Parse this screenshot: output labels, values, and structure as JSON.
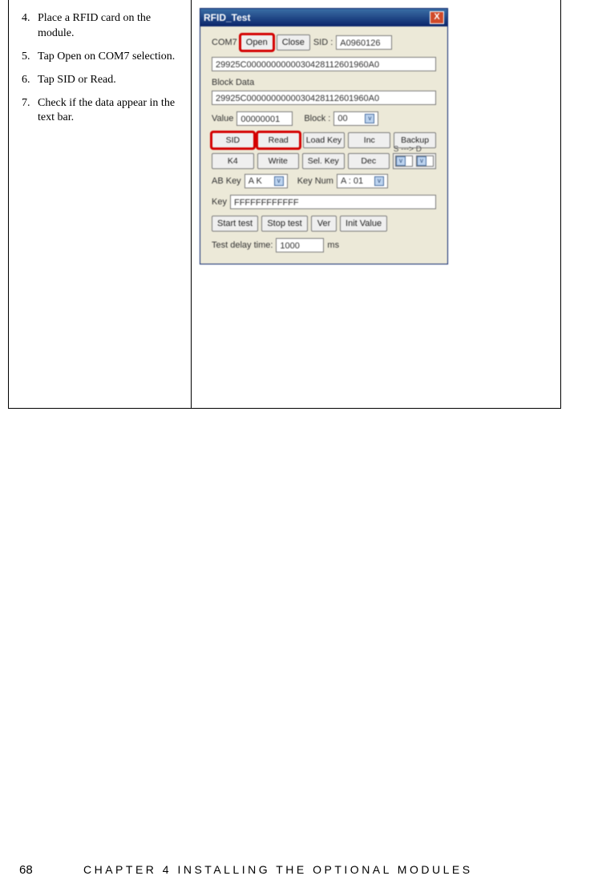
{
  "instructions": [
    {
      "n": "4.",
      "text": "Place a RFID card on the module."
    },
    {
      "n": "5.",
      "text": "Tap Open on COM7 selection."
    },
    {
      "n": "6.",
      "text": "Tap SID or Read."
    },
    {
      "n": "7.",
      "text": "Check if the data appear in the text bar."
    }
  ],
  "window": {
    "title": "RFID_Test",
    "close": "X",
    "com_label": "COM7",
    "open": "Open",
    "close_btn": "Close",
    "sid_label": "SID :",
    "sid_value": "A0960126",
    "data1": "29925C0000000000030428112601960A0",
    "block_data_label": "Block Data",
    "data2": "29925C0000000000030428112601960A0",
    "value_label": "Value",
    "value": "00000001",
    "block_label": "Block :",
    "block_sel": "00",
    "btns_row1": [
      "SID",
      "Read",
      "Load Key",
      "Inc",
      "Backup"
    ],
    "sd_label": "S ---> D",
    "btns_row2": [
      "K4",
      "Write",
      "Sel. Key",
      "Dec"
    ],
    "abkey_label": "AB Key",
    "abkey_sel": "A K",
    "keynum_label": "Key Num",
    "keynum_sel": "A : 01",
    "key_label": "Key",
    "key_value": "FFFFFFFFFFFF",
    "start": "Start test",
    "stop": "Stop test",
    "ver": "Ver",
    "init": "Init Value",
    "delay_label": "Test delay time:",
    "delay_value": "1000",
    "ms": "ms"
  },
  "footer": {
    "page": "68",
    "chapter": "CHAPTER 4 INSTALLING THE OPTIONAL MODULES"
  }
}
